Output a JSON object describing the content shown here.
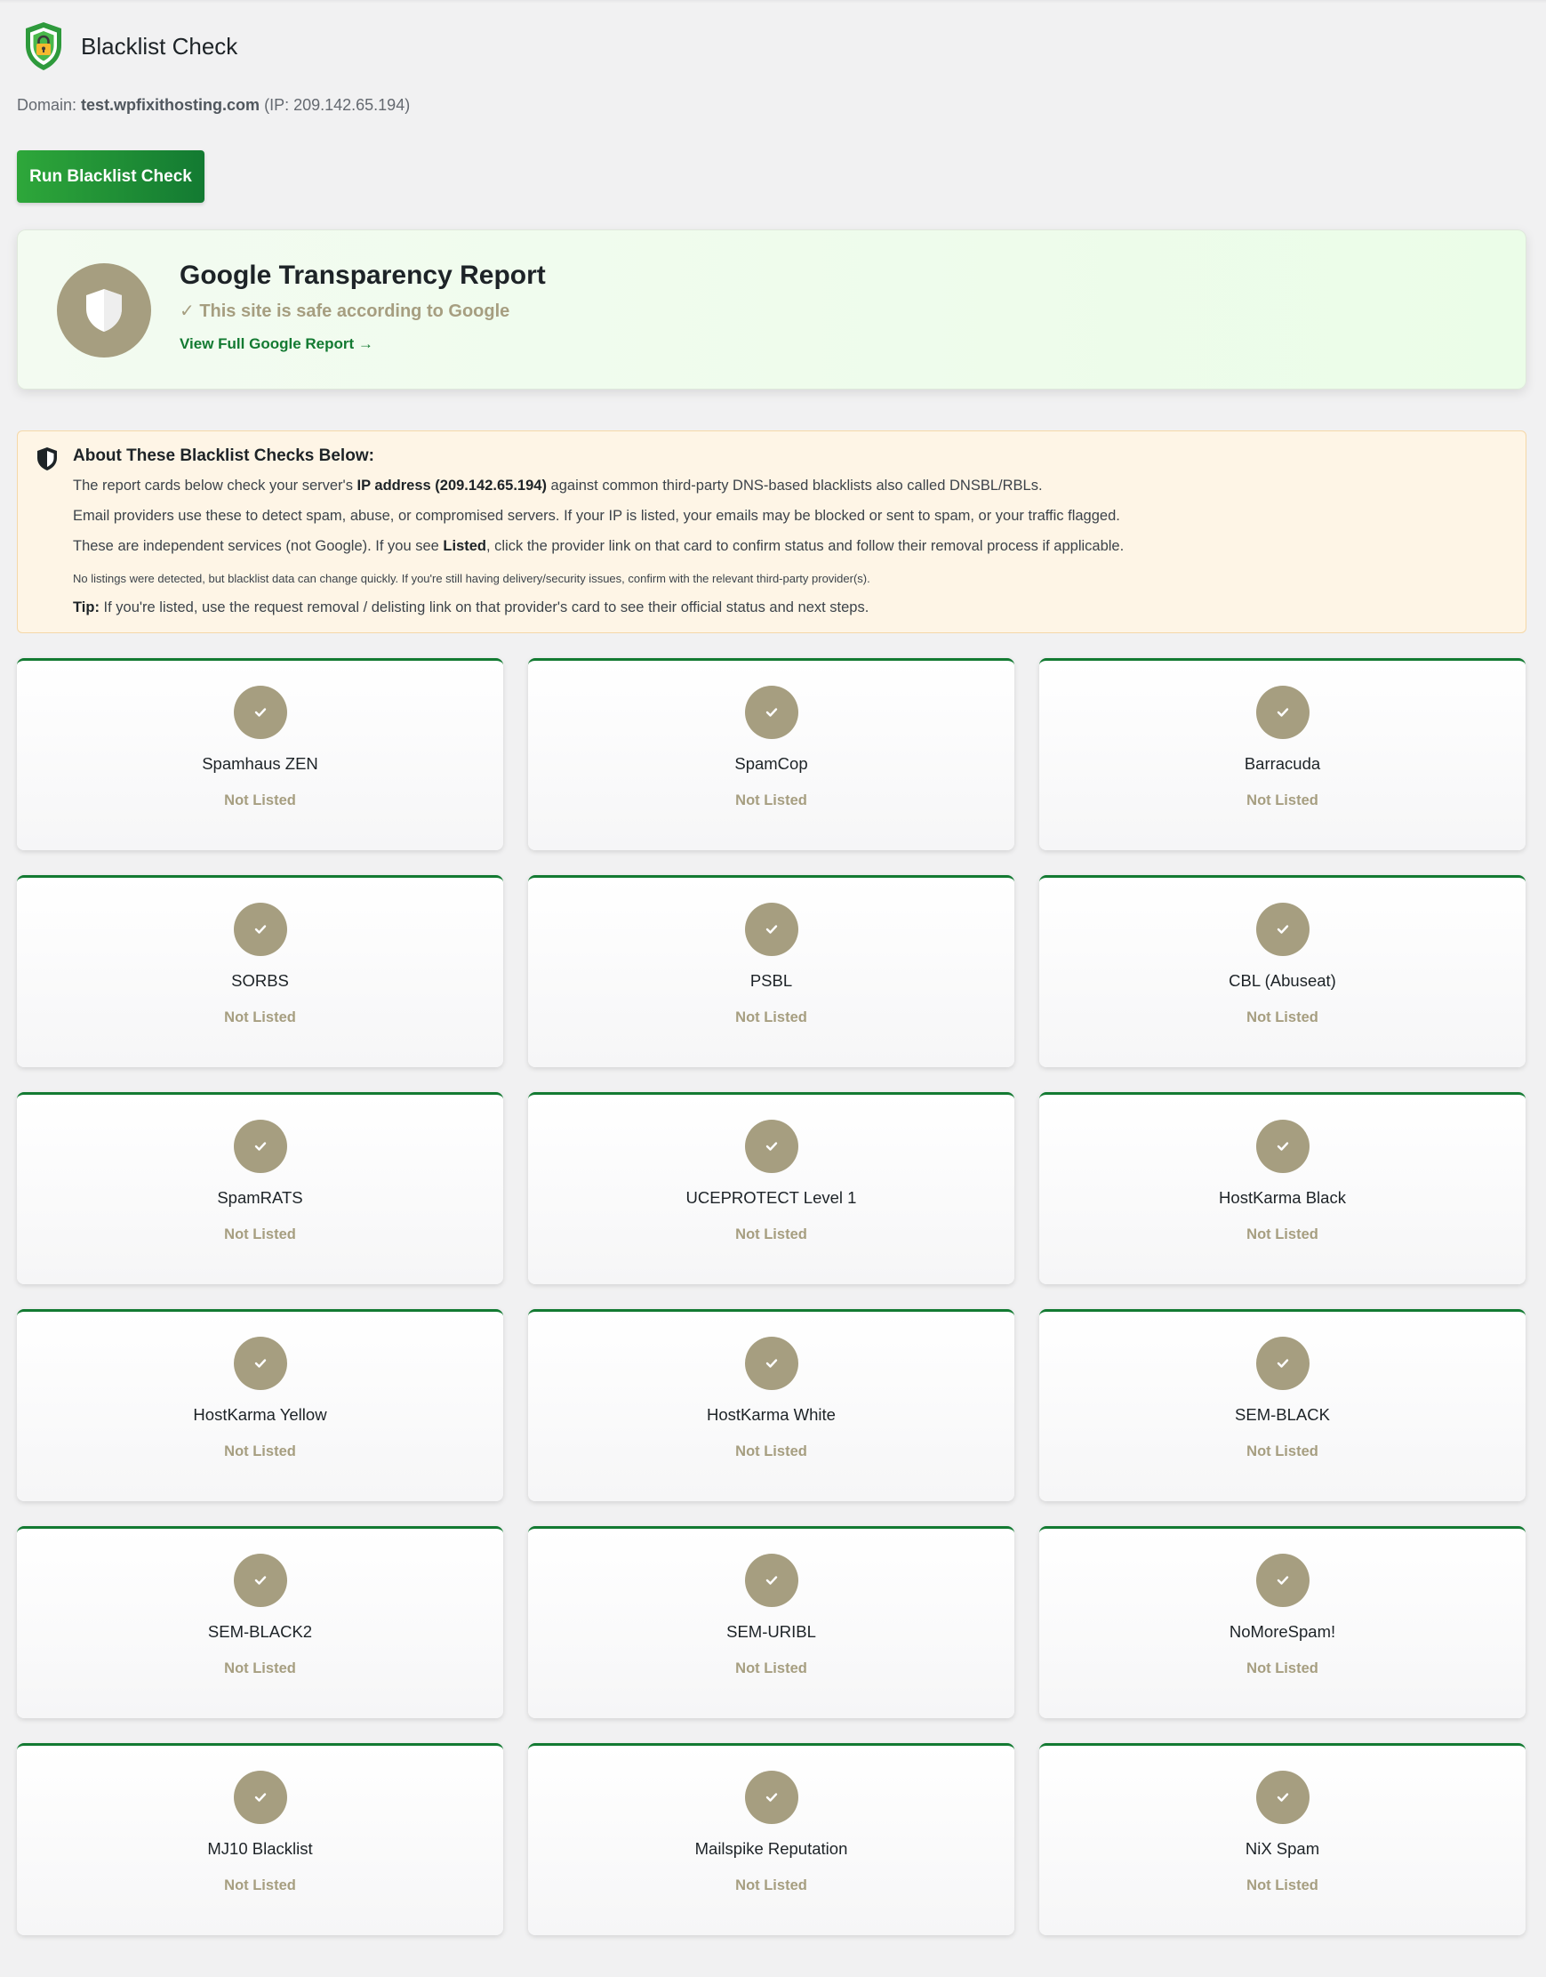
{
  "header": {
    "title": "Blacklist Check"
  },
  "domain": {
    "label": "Domain:",
    "name": "test.wpfixithosting.com",
    "ip_text": "(IP: 209.142.65.194)"
  },
  "run_button": {
    "label": "Run Blacklist Check"
  },
  "google": {
    "title": "Google Transparency Report",
    "status": "✓ This site is safe according to Google",
    "link": "View Full Google Report →",
    "icon": "shield-icon",
    "accent": "#a69e80"
  },
  "about": {
    "title": "About These Blacklist Checks Below:",
    "line1_pre": "The report cards below check your server's ",
    "line1_bold": "IP address (209.142.65.194)",
    "line1_post": " against common third-party DNS-based blacklists also called DNSBL/RBLs.",
    "line2": "Email providers use these to detect spam, abuse, or compromised servers. If your IP is listed, your emails may be blocked or sent to spam, or your traffic flagged.",
    "line3_pre": "These are independent services (not Google). If you see ",
    "line3_bold": "Listed",
    "line3_post": ", click the provider link on that card to confirm status and follow their removal process if applicable.",
    "note": "No listings were detected, but blacklist data can change quickly. If you're still having delivery/security issues, confirm with the relevant third-party provider(s).",
    "tip_label": "Tip:",
    "tip_text": " If you're listed, use the request removal / delisting link on that provider's card to see their official status and next steps."
  },
  "colors": {
    "brand_green": "#137a32",
    "neutral_badge": "#a69e80",
    "about_bg": "#fef5e6"
  },
  "cards": [
    {
      "name": "Spamhaus ZEN",
      "status": "Not Listed"
    },
    {
      "name": "SpamCop",
      "status": "Not Listed"
    },
    {
      "name": "Barracuda",
      "status": "Not Listed"
    },
    {
      "name": "SORBS",
      "status": "Not Listed"
    },
    {
      "name": "PSBL",
      "status": "Not Listed"
    },
    {
      "name": "CBL (Abuseat)",
      "status": "Not Listed"
    },
    {
      "name": "SpamRATS",
      "status": "Not Listed"
    },
    {
      "name": "UCEPROTECT Level 1",
      "status": "Not Listed"
    },
    {
      "name": "HostKarma Black",
      "status": "Not Listed"
    },
    {
      "name": "HostKarma Yellow",
      "status": "Not Listed"
    },
    {
      "name": "HostKarma White",
      "status": "Not Listed"
    },
    {
      "name": "SEM-BLACK",
      "status": "Not Listed"
    },
    {
      "name": "SEM-BLACK2",
      "status": "Not Listed"
    },
    {
      "name": "SEM-URIBL",
      "status": "Not Listed"
    },
    {
      "name": "NoMoreSpam!",
      "status": "Not Listed"
    },
    {
      "name": "MJ10 Blacklist",
      "status": "Not Listed"
    },
    {
      "name": "Mailspike Reputation",
      "status": "Not Listed"
    },
    {
      "name": "NiX Spam",
      "status": "Not Listed"
    }
  ]
}
